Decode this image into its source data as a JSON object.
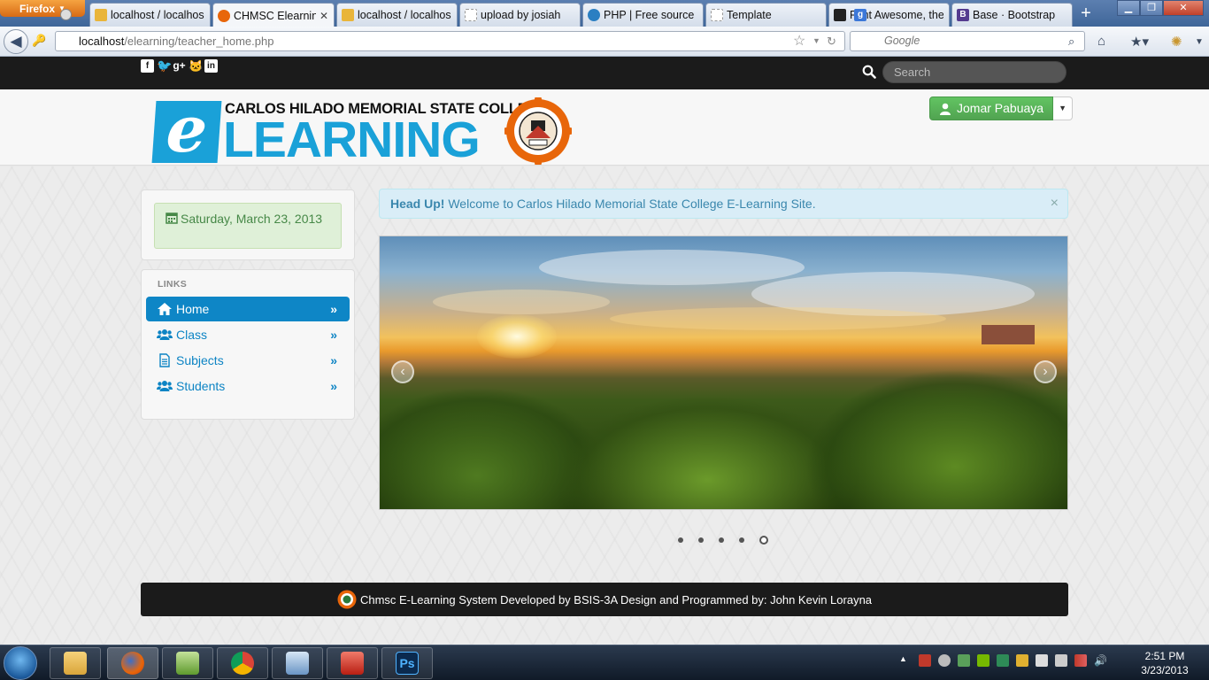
{
  "browser": {
    "menu_button": "Firefox",
    "tabs": [
      {
        "label": "localhost / localhos...",
        "favicon": "phpmyadmin-icon",
        "color": "#e9b53a"
      },
      {
        "label": "CHMSC Elearnin...",
        "favicon": "chmsc-seal-icon",
        "color": "#e8660a",
        "active": true
      },
      {
        "label": "localhost / localhos...",
        "favicon": "phpmyadmin-icon",
        "color": "#e9b53a"
      },
      {
        "label": "upload by josiah",
        "favicon": "blank-page-icon",
        "color": "#d0d0d0"
      },
      {
        "label": "PHP | Free source c...",
        "favicon": "drupal-icon",
        "color": "#2b7fc2"
      },
      {
        "label": "Template",
        "favicon": "blank-page-icon",
        "color": "#d0d0d0"
      },
      {
        "label": "Font Awesome, the...",
        "favicon": "flag-icon",
        "color": "#222222"
      },
      {
        "label": "Base · Bootstrap",
        "favicon": "bootstrap-icon",
        "color": "#553b8f"
      }
    ],
    "url_host": "localhost",
    "url_path": "/elearning/teacher_home.php",
    "search_engine": "Google"
  },
  "site": {
    "search_placeholder": "Search",
    "social_icons": [
      "facebook-icon",
      "twitter-icon",
      "google-plus-icon",
      "github-icon",
      "linkedin-icon"
    ],
    "logo": {
      "college_name": "CARLOS HILADO MEMORIAL STATE COLLEGE",
      "e_letter": "e",
      "learning_word": "LEARNING"
    },
    "user_button": "Jomar Pabuaya",
    "date": "Saturday, March 23, 2013",
    "links_header": "LINKS",
    "nav": [
      {
        "label": "Home",
        "icon": "home-icon",
        "active": true
      },
      {
        "label": "Class",
        "icon": "group-icon"
      },
      {
        "label": "Subjects",
        "icon": "file-icon"
      },
      {
        "label": "Students",
        "icon": "group-icon"
      }
    ],
    "alert": {
      "strong": "Head Up!",
      "text": "Welcome to Carlos Hilado Memorial State College E-Learning Site."
    },
    "carousel": {
      "slide_count": 5,
      "active_index": 4
    },
    "footer": "Chmsc E-Learning System Developed by BSIS-3A Design and Programmed by: John Kevin Lorayna"
  },
  "taskbar": {
    "time": "2:51 PM",
    "date": "3/23/2013",
    "apps": [
      "windows-explorer-icon",
      "firefox-icon",
      "notepad-plus-plus-icon",
      "chrome-icon",
      "virtualbox-icon",
      "acrobat-icon",
      "photoshop-icon"
    ]
  },
  "colors": {
    "primary": "#0e86c6",
    "success": "#51a351",
    "info_bg": "#d9edf7",
    "dark_bar": "#1b1b1b"
  }
}
